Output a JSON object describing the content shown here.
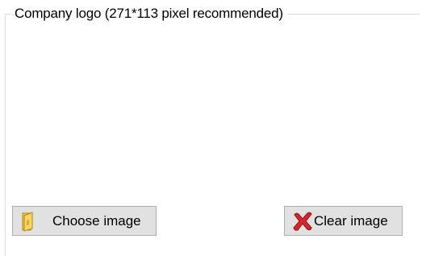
{
  "logo_group": {
    "title": "Company logo (271*113 pixel recommended)",
    "choose_button_label": "Choose image",
    "clear_button_label": "Clear image",
    "choose_icon": "folder-icon",
    "clear_icon": "red-x-icon"
  },
  "colors": {
    "button_face": "#e1e1e1",
    "button_border": "#adadad",
    "groupbox_border": "#dcdcdc",
    "folder_yellow": "#f4c542",
    "clear_red": "#d4262b"
  }
}
